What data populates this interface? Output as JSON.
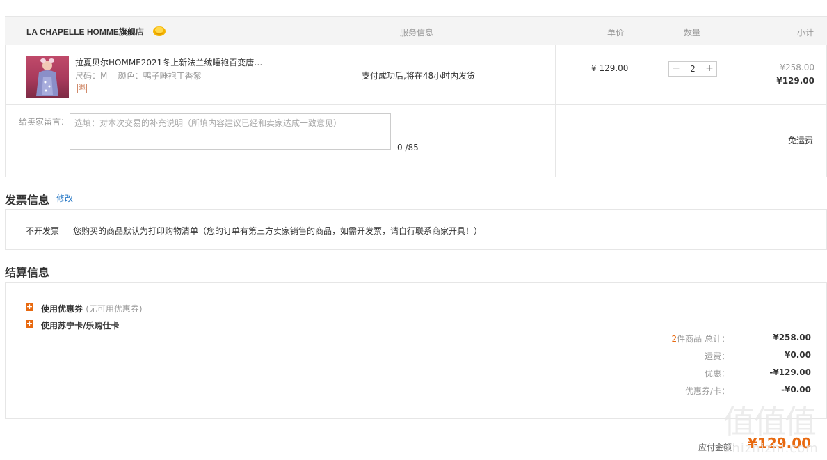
{
  "store": {
    "name": "LA CHAPELLE HOMME旗舰店",
    "badge_icon": "gold-store-badge-icon"
  },
  "columns": {
    "service": "服务信息",
    "unit_price": "单价",
    "quantity": "数量",
    "subtotal": "小计"
  },
  "product": {
    "title": "拉夏贝尔HOMME2021冬上新法兰绒睡袍百变唐老...",
    "specs": "尺码：M    颜色：鸭子睡袍丁香紫",
    "refund_tag": "退",
    "service_info": "支付成功后,将在48小时内发货",
    "unit_price": "¥ 129.00",
    "quantity": "2",
    "original_subtotal": "¥258.00",
    "subtotal": "¥129.00"
  },
  "message": {
    "label": "给卖家留言：",
    "placeholder": "选填：对本次交易的补充说明（所填内容建议已经和卖家达成一致意见）",
    "value": "",
    "counter": "0 /85"
  },
  "shipping": "免运费",
  "invoice": {
    "section_title": "发票信息",
    "edit_label": "修改",
    "type": "不开发票",
    "note": "您购买的商品默认为打印购物清单（您的订单有第三方卖家销售的商品，如需开发票，请自行联系商家开具！）"
  },
  "settlement": {
    "section_title": "结算信息",
    "options": [
      {
        "label": "使用优惠券",
        "hint": "(无可用优惠券)"
      },
      {
        "label": "使用苏宁卡/乐购仕卡",
        "hint": ""
      }
    ],
    "summary": {
      "count": "2",
      "total_label": "件商品 总计：",
      "total_value": "¥258.00",
      "freight_label": "运费：",
      "freight_value": "¥0.00",
      "discount_label": "优惠：",
      "discount_value": "-¥129.00",
      "coupon_label": "优惠券/卡：",
      "coupon_value": "-¥0.00"
    },
    "payable_label": "应付金额：",
    "payable_value": "¥129.00"
  },
  "watermark": {
    "glyphs": "值值值",
    "text": "zhizhizhi.com"
  },
  "colors": {
    "accent": "#e8690f",
    "link": "#2a7ac6",
    "border": "#e6e6e6",
    "header_bg": "#f4f4f4"
  }
}
